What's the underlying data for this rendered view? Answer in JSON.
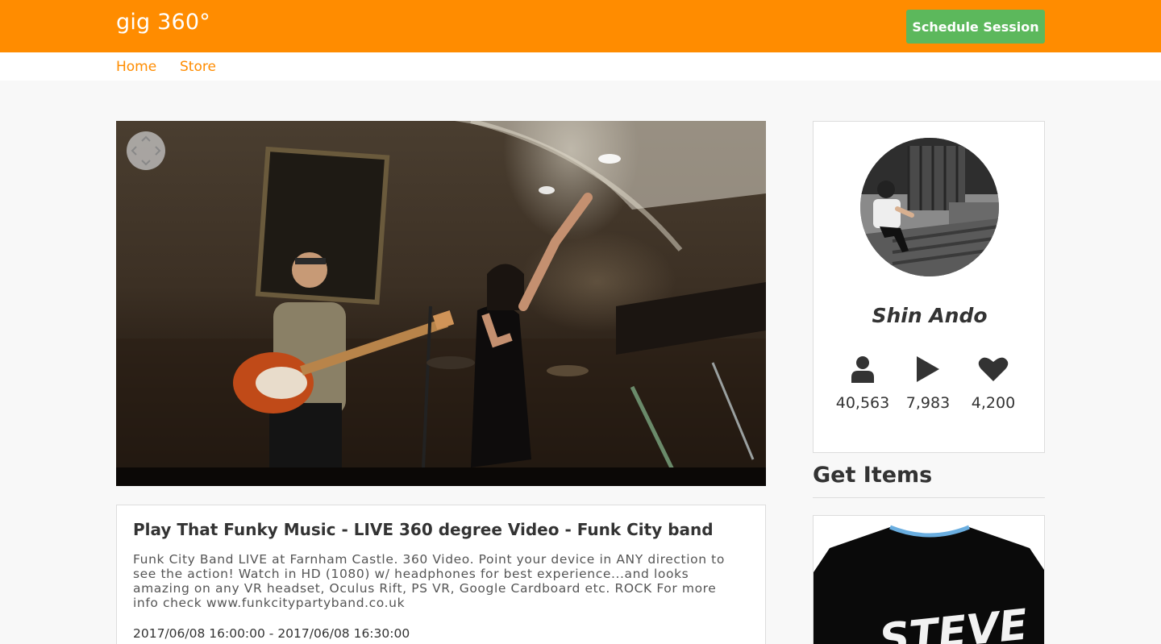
{
  "header": {
    "brand": "gig 360°",
    "schedule_label": "Schedule Session"
  },
  "nav": {
    "items": [
      {
        "label": "Home"
      },
      {
        "label": "Store"
      }
    ]
  },
  "video": {
    "title": "Play That Funky Music - LIVE 360 degree Video - Funk City band",
    "description": "Funk City Band LIVE at Farnham Castle. 360 Video. Point your device in ANY direction to see the action! Watch in HD (1080) w/ headphones for best experience...and looks amazing on any VR headset, Oculus Rift, PS VR, Google Cardboard etc. ROCK For more info check www.funkcitypartyband.co.uk",
    "time_range": "2017/06/08 16:00:00 - 2017/06/08 16:30:00"
  },
  "profile": {
    "name": "Shin Ando",
    "stats": {
      "followers": "40,563",
      "plays": "7,983",
      "likes": "4,200"
    }
  },
  "items": {
    "heading": "Get Items",
    "products": [
      {
        "print_text": "STEVE"
      }
    ]
  },
  "icons": {
    "pan": "pan-arrows-icon",
    "followers": "user-icon",
    "plays": "play-icon",
    "likes": "heart-icon"
  },
  "colors": {
    "brand_orange": "#ff8c00",
    "schedule_green": "#5cb85c",
    "text_dark": "#333333"
  }
}
